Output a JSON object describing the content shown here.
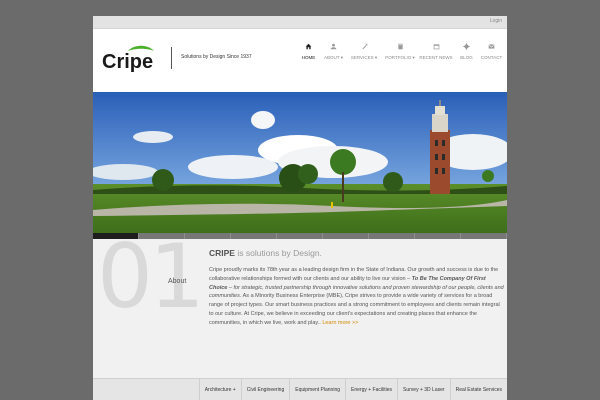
{
  "topbar": {
    "login_label": "Login"
  },
  "brand": {
    "logo_text": "Cripe",
    "tagline": "Solutions by Design Since 1937"
  },
  "nav": {
    "items": [
      {
        "label": "HOME",
        "icon": "home-icon"
      },
      {
        "label": "ABOUT",
        "icon": "person-icon"
      },
      {
        "label": "SERVICES",
        "icon": "tools-icon"
      },
      {
        "label": "PORTFOLIO",
        "icon": "book-icon"
      },
      {
        "label": "RECENT NEWS",
        "icon": "calendar-icon"
      },
      {
        "label": "BLOG",
        "icon": "gear-icon"
      },
      {
        "label": "CONTACT",
        "icon": "mail-icon"
      }
    ]
  },
  "about": {
    "number": "01",
    "label": "About",
    "title_brand": "CRIPE",
    "title_rest": " is solutions by Design.",
    "p1_start": "Cripe proudly marks its 78th year as a leading design firm in the State of Indiana. Our growth and success is due to the collaborative relationships formed with our clients and our ability to live our vision – ",
    "p1_bold": "To Be The Company Of First Choice",
    "p1_italic": " – for strategic, trusted partnership through innovative solutions and proven stewardship of our people, clients and communities.",
    "p2": " As a Minority Business Enterprise (MBE), Cripe strives to provide a wide variety of services for a broad range of project types. Our smart business practices and a strong commitment to employees and clients remain integral to our culture. At Cripe, we believe in exceeding our client's expectations and creating places that enhance the communities, in which we live, work and play.. ",
    "learn_more": "Learn more >>"
  },
  "services": {
    "items": [
      "Architecture +",
      "Civil Engineering",
      "Equipment Planning",
      "Energy + Facilities",
      "Survey + 3D Laser",
      "Real Estate Services"
    ]
  },
  "colors": {
    "brand_green": "#4caf2b",
    "link_orange": "#d08a00",
    "page_bg": "#6b6b6b"
  }
}
